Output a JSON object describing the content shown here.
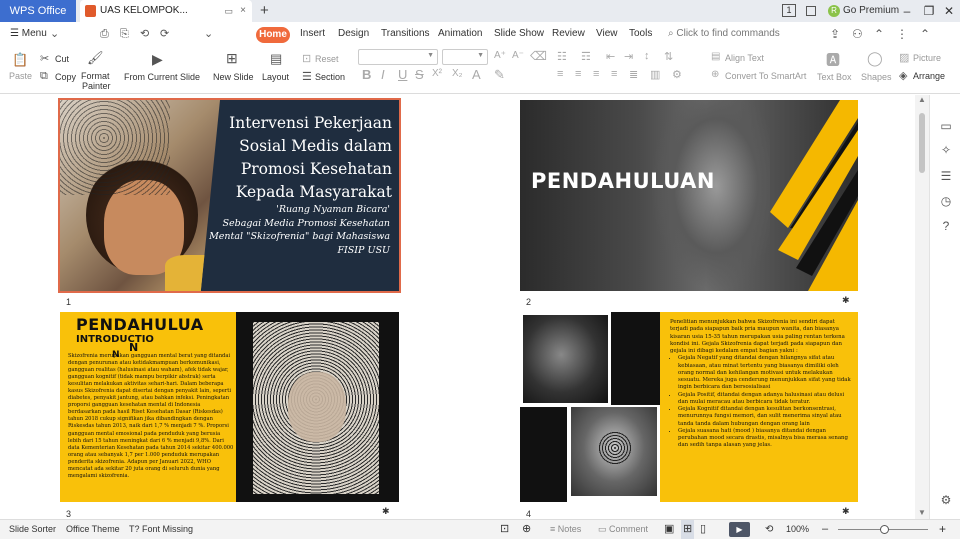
{
  "titlebar": {
    "app_tab": "WPS Office",
    "doc_tab": "UAS KELOMPOK... SKIZOFRENIA",
    "doc_pin_icon": "▭",
    "close_glyph": "×",
    "new_tab_glyph": "+",
    "window_count": "1",
    "avatar_letter": "R",
    "go_premium": "Go Premium",
    "min_glyph": "–",
    "restore_glyph": "❐",
    "close_win_glyph": "✕"
  },
  "menurow": {
    "menu_label": "☰ Menu",
    "quick_glyphs": [
      "⌄",
      "⎙",
      "⎘",
      "⟲",
      "⟳",
      "⌄"
    ],
    "tabs": [
      "Home",
      "Insert",
      "Design",
      "Transitions",
      "Animation",
      "Slide Show",
      "Review",
      "View",
      "Tools"
    ],
    "search_placeholder": "Click to find commands"
  },
  "toolbar": {
    "paste": "Paste",
    "cut": "Cut",
    "copy": "Copy",
    "format_painter_1": "Format",
    "format_painter_2": "Painter",
    "from_current_slide": "From Current Slide",
    "new_slide": "New Slide",
    "layout": "Layout",
    "reset": "Reset",
    "section": "Section",
    "bold": "B",
    "italic": "I",
    "underline": "U",
    "strike": "S",
    "superscript": "X²",
    "subscript": "X₂",
    "align_text": "Align Text",
    "convert_smartart": "Convert To SmartArt",
    "text_box": "Text Box",
    "shapes": "Shapes",
    "picture": "Picture",
    "arrange": "Arrange"
  },
  "slides": [
    {
      "number": "1",
      "title": "Intervensi Pekerjaan Sosial Medis dalam Promosi Kesehatan Kepada Masyarakat",
      "subtitle_1": "'Ruang Nyaman Bicara'",
      "subtitle_2": "Sebagai Media Promosi Kesehatan",
      "subtitle_3": "Mental \"Skizofrenia\" bagi Mahasiswa",
      "subtitle_4": "FISIP USU"
    },
    {
      "number": "2",
      "title": "PENDAHULUAN"
    },
    {
      "number": "3",
      "title": "PENDAHULUA",
      "subtitle": "INTRODUCTIO",
      "stray_n1": "N",
      "stray_n2": "N",
      "body": "Skizofrenia merupakan gangguan mental berat yang ditandai dengan penurunan atau ketidakmampuan berkomunikasi, gangguan realitas (halusinasi atau waham), afek tidak wajar, gangguan kognitif (tidak mampu berpikir abstrak) serta kesulitan melakukan aktivitas sehari-hari. Dalam beberapa kasus Skizofrenia dapat disertai dengan penyakit lain, seperti diabetes, penyakit jantung, atau bahkan infeksi. Peningkatan proporsi gangguan kesehatan mental di Indonesia berdasarkan pada hasil Riset Kesehatan Dasar (Riskesdas) tahun 2018 cukup signifikan jika dibandingkan dengan Riskesdas tahun 2013, naik dari 1,7 % menjadi 7 %. Proporsi gangguan mental emosional pada penduduk yang berusia lebih dari 15 tahun meningkat dari 6 % menjadi 9,8%. Dari data Kementerian Kesehatan pada tahun 2014 sekitar 400.000 orang atau sebanyak 1,7 per 1.000 penduduk merupakan penderita skizofrenia. Adapun per Januari 2022, WHO mencatat ada sekitar 20 juta orang di seluruh dunia yang mengalami skizofrenia."
    },
    {
      "number": "4",
      "intro": "Penelitian menunjukkan bahwa Skizofrenia ini sendiri dapat terjadi pada siapapun baik pria maupun wanita, dan biasanya kisaran usia 15-35 tahun merupakan usia paling rentan terkena kondisi ini. Gejala Skizofrenia dapat terjadi pada siapapun dan gejala ini dibagi kedalam empat bagian yakni :",
      "bullets": [
        "Gejala Negatif yang ditandai dengan hilangnya sifat atau kebiasaan, atau minat tertentu yang biasanya dimiliki oleh orang normal dan kehilangan motivasi untuk melakukan sesuatu. Mereka juga cenderung menunjukkan sifat yang tidak ingin berbicara dan bersosialisasi",
        "Gejala Positif, ditandai dengan adanya halusinasi atau delusi dan mulai meracau atau berbicara tidak teratur.",
        "Gejala Kognitif ditandai dengan kesulitan berkonsentrasi, menurunnya fungsi memori, dan sulit menerima sinyal atau tanda tanda dalam hubungan dengan orang lain",
        "Gejala suasana hati (mood ) biasanya ditandai dengan perubahan mood secara drastis, misalnya bisa merasa senang dan sedih tanpa alasan yang jelas."
      ]
    }
  ],
  "statusbar": {
    "slide_sorter": "Slide Sorter",
    "office_theme": "Office Theme",
    "font_missing": "Font Missing",
    "notes": "Notes",
    "comment": "Comment",
    "zoom": "100%",
    "zoom_minus": "–",
    "zoom_plus": "+"
  },
  "colors": {
    "accent": "#f06a3c",
    "wps_blue": "#3d6ecf",
    "slide_yellow": "#f9c10a",
    "slide_navy": "#1f2d3f"
  }
}
